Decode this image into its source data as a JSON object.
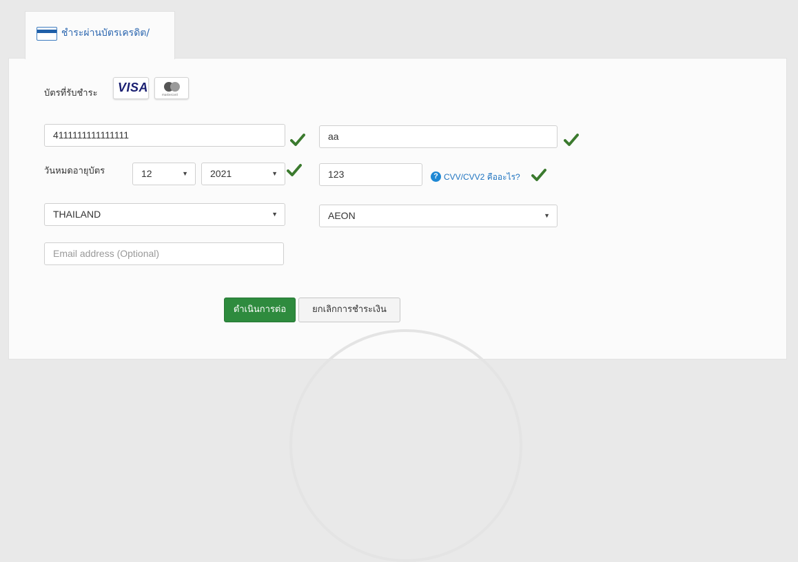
{
  "tab": {
    "label": "ชำระผ่านบัตรเครดิต/"
  },
  "accepted_cards": {
    "label": "บัตรที่รับชำระ",
    "visa_text": "VISA",
    "mastercard_text": "mastercard"
  },
  "form": {
    "card_number": {
      "value": "4111111111111111"
    },
    "card_holder": {
      "value": "aa"
    },
    "expiry": {
      "label": "วันหมดอายุบัตร",
      "month": "12",
      "year": "2021"
    },
    "cvv": {
      "value": "123",
      "help_text": "CVV/CVV2 คืออะไร?"
    },
    "country": {
      "value": "THAILAND"
    },
    "bank": {
      "value": "AEON"
    },
    "email": {
      "placeholder": "Email address (Optional)"
    }
  },
  "buttons": {
    "continue_label": "ดำเนินการต่อ",
    "cancel_label": "ยกเลิกการชำระเงิน"
  },
  "colors": {
    "primary_button": "#2e8b3e",
    "check": "#3b7a2e",
    "link": "#1e73c0",
    "tab_label": "#2e68b0"
  },
  "icons": [
    "credit-card-icon",
    "check-icon",
    "help-icon",
    "caret-down-icon"
  ]
}
